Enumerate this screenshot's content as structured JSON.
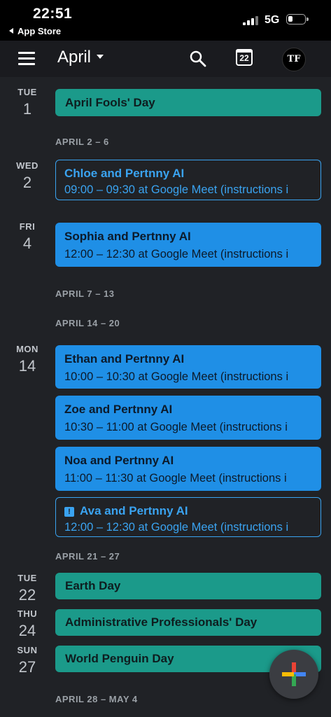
{
  "status_bar": {
    "time": "22:51",
    "back_label": "App Store",
    "network": "5G"
  },
  "app_bar": {
    "month": "April",
    "today_date": "22",
    "avatar_initials": "TF"
  },
  "days": [
    {
      "dow": "TUE",
      "num": "1"
    },
    {
      "dow": "WED",
      "num": "2"
    },
    {
      "dow": "FRI",
      "num": "4"
    },
    {
      "dow": "MON",
      "num": "14"
    },
    {
      "dow": "TUE",
      "num": "22"
    },
    {
      "dow": "THU",
      "num": "24"
    },
    {
      "dow": "SUN",
      "num": "27"
    }
  ],
  "week_ranges": [
    "APRIL 2 – 6",
    "APRIL 7 – 13",
    "APRIL 14 – 20",
    "APRIL 21 – 27",
    "APRIL 28 – MAY 4"
  ],
  "events": [
    {
      "title": "April Fools' Day"
    },
    {
      "title": "Chloe and Pertnny AI",
      "sub": "09:00 – 09:30 at Google Meet (instructions i"
    },
    {
      "title": "Sophia and Pertnny AI",
      "sub": "12:00 – 12:30 at Google Meet (instructions i"
    },
    {
      "title": "Ethan and Pertnny AI",
      "sub": "10:00 – 10:30 at Google Meet (instructions i"
    },
    {
      "title": "Zoe and Pertnny AI",
      "sub": "10:30 – 11:00 at Google Meet (instructions i"
    },
    {
      "title": "Noa and Pertnny AI",
      "sub": "11:00 – 11:30 at Google Meet (instructions i"
    },
    {
      "title": "Ava and Pertnny AI",
      "sub": "12:00 – 12:30 at Google Meet (instructions i"
    },
    {
      "title": "Earth Day"
    },
    {
      "title": "Administrative Professionals' Day"
    },
    {
      "title": "World Penguin Day"
    }
  ],
  "colors": {
    "holiday": "#1b9a8a",
    "event": "#1f8fe6",
    "fab_plus": [
      "#ea4335",
      "#4285f4",
      "#fbbc05",
      "#34a853"
    ]
  },
  "icons": {
    "menu": "hamburger-icon",
    "search": "search-icon",
    "today": "calendar-today-icon",
    "fab": "plus-icon",
    "alert": "exclamation-icon"
  }
}
